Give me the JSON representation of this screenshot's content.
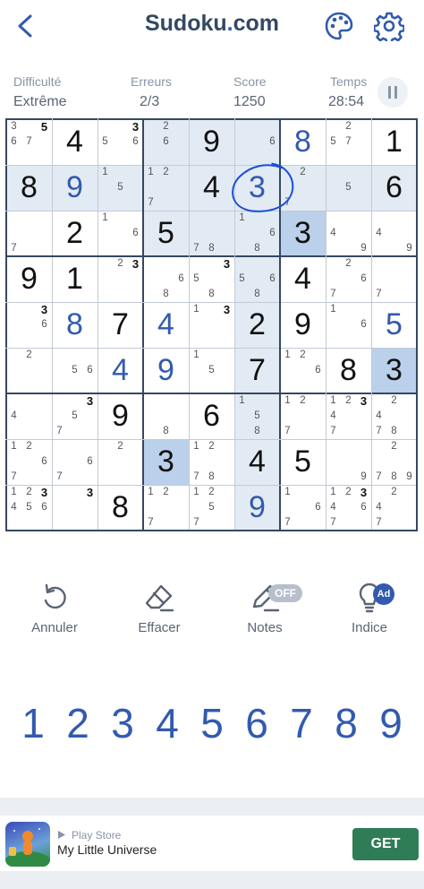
{
  "header": {
    "title_main": "Sudoku",
    "title_dot": ".",
    "title_end": "com"
  },
  "stats": [
    {
      "label": "Difficulté",
      "value": "Extrême"
    },
    {
      "label": "Erreurs",
      "value": "2/3"
    },
    {
      "label": "Score",
      "value": "1250"
    },
    {
      "label": "Temps",
      "value": "28:54"
    }
  ],
  "colors": {
    "given": "#111111",
    "entered": "#325aaf",
    "highlight": "#e2ebf3",
    "selected": "#bbd0ea",
    "circle": "#1d4fd6",
    "accent": "#325aaf",
    "get_button": "#2e7d57"
  },
  "board": {
    "selected": [
      1,
      5
    ],
    "circled": [
      1,
      5
    ],
    "cells": [
      [
        {
          "n": [
            "3",
            "",
            "5",
            "6",
            "7",
            "",
            ""
          ],
          "nb": [
            2
          ]
        },
        {
          "v": "4"
        },
        {
          "n": [
            "",
            "",
            "3",
            "5",
            "",
            "6",
            ""
          ],
          "nb": [
            2
          ]
        },
        {
          "n": [
            "",
            "2",
            "",
            "",
            "6",
            "",
            ""
          ]
        },
        {
          "v": "9"
        },
        {
          "n": [
            "",
            "",
            "",
            "",
            "",
            "6",
            ""
          ]
        },
        {
          "v": "8",
          "e": true
        },
        {
          "n": [
            "",
            "2",
            "",
            "5",
            "7",
            "",
            ""
          ]
        },
        {
          "v": "1"
        }
      ],
      [
        {
          "v": "8"
        },
        {
          "v": "9",
          "e": true
        },
        {
          "n": [
            "1",
            "",
            "",
            "",
            "5",
            "",
            ""
          ]
        },
        {
          "n": [
            "1",
            "2",
            "",
            "",
            "",
            "",
            "7"
          ]
        },
        {
          "v": "4"
        },
        {
          "v": "3",
          "e": true
        },
        {
          "n": [
            "",
            "2",
            "",
            "",
            "",
            "",
            "7"
          ]
        },
        {
          "n": [
            "",
            "",
            "",
            "",
            "5",
            "",
            ""
          ]
        },
        {
          "v": "6"
        }
      ],
      [
        {
          "n": [
            "",
            "",
            "",
            "",
            "",
            "",
            "7"
          ]
        },
        {
          "v": "2"
        },
        {
          "n": [
            "1",
            "",
            "",
            "",
            "",
            "6",
            ""
          ]
        },
        {
          "v": "5"
        },
        {
          "n": [
            "",
            "",
            "",
            "",
            "",
            "",
            "7",
            "8"
          ]
        },
        {
          "n": [
            "1",
            "",
            "",
            "",
            "",
            "6",
            "",
            "8"
          ]
        },
        {
          "v": "3"
        },
        {
          "n": [
            "",
            "",
            "",
            "4",
            "",
            "",
            "",
            "",
            "9"
          ]
        },
        {
          "n": [
            "",
            "",
            "",
            "4",
            "",
            "",
            "",
            "",
            "9"
          ]
        }
      ],
      [
        {
          "v": "9"
        },
        {
          "v": "1"
        },
        {
          "n": [
            "",
            "2",
            "3"
          ],
          "nb": [
            2
          ]
        },
        {
          "n": [
            "",
            "",
            "",
            "",
            "",
            "6",
            "",
            "8"
          ]
        },
        {
          "n": [
            "",
            "",
            "3",
            "5",
            "",
            "",
            "",
            "8"
          ],
          "nb": [
            2
          ]
        },
        {
          "n": [
            "",
            "",
            "",
            "5",
            "",
            "6",
            "",
            "8"
          ]
        },
        {
          "v": "4"
        },
        {
          "n": [
            "",
            "2",
            "",
            "",
            "",
            "6",
            "7"
          ]
        },
        {
          "n": [
            "",
            "",
            "",
            "",
            "",
            "",
            "7"
          ]
        }
      ],
      [
        {
          "n": [
            "",
            "",
            "3",
            "",
            "",
            "6"
          ],
          "nb": [
            2
          ]
        },
        {
          "v": "8",
          "e": true
        },
        {
          "v": "7"
        },
        {
          "v": "4",
          "e": true
        },
        {
          "n": [
            "1",
            "",
            "3"
          ],
          "nb": [
            2
          ]
        },
        {
          "v": "2"
        },
        {
          "v": "9"
        },
        {
          "n": [
            "1",
            "",
            "",
            "",
            "",
            "6"
          ]
        },
        {
          "v": "5",
          "e": true
        }
      ],
      [
        {
          "n": [
            "",
            "2"
          ]
        },
        {
          "n": [
            "",
            "",
            "",
            "",
            "5",
            "6"
          ]
        },
        {
          "v": "4",
          "e": true
        },
        {
          "v": "9",
          "e": true
        },
        {
          "n": [
            "1",
            "",
            "",
            "",
            "5"
          ]
        },
        {
          "v": "7"
        },
        {
          "n": [
            "1",
            "2",
            "",
            "",
            "",
            "6"
          ]
        },
        {
          "v": "8"
        },
        {
          "v": "3"
        }
      ],
      [
        {
          "n": [
            "",
            "",
            "",
            "4"
          ]
        },
        {
          "n": [
            "",
            "",
            "3",
            "",
            "5",
            "",
            "7"
          ],
          "nb": [
            2
          ]
        },
        {
          "v": "9"
        },
        {
          "n": [
            "",
            "",
            "",
            "",
            "",
            "",
            "",
            "8"
          ]
        },
        {
          "v": "6"
        },
        {
          "n": [
            "1",
            "",
            "",
            "",
            "5",
            "",
            "",
            "8"
          ]
        },
        {
          "n": [
            "1",
            "2",
            "",
            "",
            "",
            "",
            "7"
          ]
        },
        {
          "n": [
            "1",
            "2",
            "3",
            "4",
            "",
            "",
            "7"
          ],
          "nb": [
            2
          ]
        },
        {
          "n": [
            "",
            "2",
            "",
            "4",
            "",
            "",
            "7",
            "8"
          ]
        }
      ],
      [
        {
          "n": [
            "1",
            "2",
            "",
            "",
            "",
            "6",
            "7"
          ]
        },
        {
          "n": [
            "",
            "",
            "",
            "",
            "",
            "6",
            "7"
          ]
        },
        {
          "n": [
            "",
            "2"
          ]
        },
        {
          "v": "3"
        },
        {
          "n": [
            "1",
            "2",
            "",
            "",
            "",
            "",
            "7",
            "8"
          ]
        },
        {
          "v": "4"
        },
        {
          "v": "5"
        },
        {
          "n": [
            "",
            "",
            "",
            "",
            "",
            "",
            "",
            "",
            "9"
          ]
        },
        {
          "n": [
            "",
            "2",
            "",
            "",
            "",
            "",
            "7",
            "8",
            "9"
          ]
        }
      ],
      [
        {
          "n": [
            "1",
            "2",
            "3",
            "4",
            "5",
            "6"
          ],
          "nb": [
            2
          ]
        },
        {
          "n": [
            "",
            "",
            "3"
          ],
          "nb": [
            2
          ]
        },
        {
          "v": "8"
        },
        {
          "n": [
            "1",
            "2",
            "",
            "",
            "",
            "",
            "7"
          ]
        },
        {
          "n": [
            "1",
            "2",
            "",
            "",
            "5",
            "",
            "7"
          ]
        },
        {
          "v": "9",
          "e": true
        },
        {
          "n": [
            "1",
            "",
            "",
            "",
            "",
            "6",
            "7"
          ]
        },
        {
          "n": [
            "1",
            "2",
            "3",
            "4",
            "",
            "6",
            "7"
          ],
          "nb": [
            2
          ]
        },
        {
          "n": [
            "",
            "2",
            "",
            "4",
            "",
            "",
            "7"
          ]
        }
      ]
    ]
  },
  "tools": [
    {
      "label": "Annuler",
      "icon": "undo-icon"
    },
    {
      "label": "Effacer",
      "icon": "eraser-icon"
    },
    {
      "label": "Notes",
      "icon": "pencil-icon",
      "badge": "OFF"
    },
    {
      "label": "Indice",
      "icon": "lightbulb-icon",
      "badge": "Ad"
    }
  ],
  "numpad": [
    "1",
    "2",
    "3",
    "4",
    "5",
    "6",
    "7",
    "8",
    "9"
  ],
  "ad": {
    "store": "Play Store",
    "app_name": "My Little Universe",
    "button": "GET"
  }
}
